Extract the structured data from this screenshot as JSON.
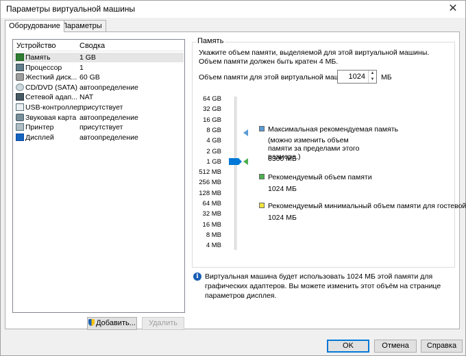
{
  "window": {
    "title": "Параметры виртуальной машины"
  },
  "tabs": [
    "Оборудование",
    "Параметры"
  ],
  "devices": {
    "col_device": "Устройство",
    "col_summary": "Сводка",
    "rows": [
      {
        "name": "Память",
        "summary": "1 GB",
        "icon": "memory-icon"
      },
      {
        "name": "Процессор",
        "summary": "1",
        "icon": "processor-icon"
      },
      {
        "name": "Жесткий диск...",
        "summary": "60 GB",
        "icon": "hard-disk-icon"
      },
      {
        "name": "CD/DVD (SATA)",
        "summary": "автоопределение",
        "icon": "cd-dvd-icon"
      },
      {
        "name": "Сетевой адап...",
        "summary": "NAT",
        "icon": "network-adapter-icon"
      },
      {
        "name": "USB-контроллер",
        "summary": "присутствует",
        "icon": "usb-icon"
      },
      {
        "name": "Звуковая карта",
        "summary": "автоопределение",
        "icon": "sound-card-icon"
      },
      {
        "name": "Принтер",
        "summary": "присутствует",
        "icon": "printer-icon"
      },
      {
        "name": "Дисплей",
        "summary": "автоопределение",
        "icon": "display-icon"
      }
    ],
    "add_label": "Добавить...",
    "remove_label": "Удалить"
  },
  "memory": {
    "group_label": "Память",
    "description": "Укажите объем памяти, выделяемой для этой виртуальной машины. Объем памяти должен быть кратен 4 МБ.",
    "field_label": "Объем памяти для этой виртуальной машины:",
    "value": "1024",
    "unit": "МБ",
    "scale": [
      "64 GB",
      "32 GB",
      "16 GB",
      "8 GB",
      "4 GB",
      "2 GB",
      "1 GB",
      "512 MB",
      "256 MB",
      "128 MB",
      "64 MB",
      "32 MB",
      "16 MB",
      "8 MB",
      "4 MB"
    ],
    "legend": {
      "max_title": "Максимальная рекомендуемая память",
      "max_note": "(можно изменить объем памяти за пределами этого размера.)",
      "max_value": "6300 МБ",
      "rec_title": "Рекомендуемый объем памяти",
      "rec_value": "1024 МБ",
      "min_title": "Рекомендуемый минимальный объем памяти для гостевой ОС",
      "min_value": "1024 МБ"
    },
    "colors": {
      "max": "#5b9bd5",
      "rec": "#4caf50",
      "min": "#f0e442",
      "thumb": "#0078d7"
    },
    "info": "Виртуальная машина будет использовать 1024 МБ этой памяти для графических адаптеров. Вы можете изменить этот объём на странице параметров дисплея."
  },
  "footer": {
    "ok": "OK",
    "cancel": "Отмена",
    "help": "Справка"
  }
}
